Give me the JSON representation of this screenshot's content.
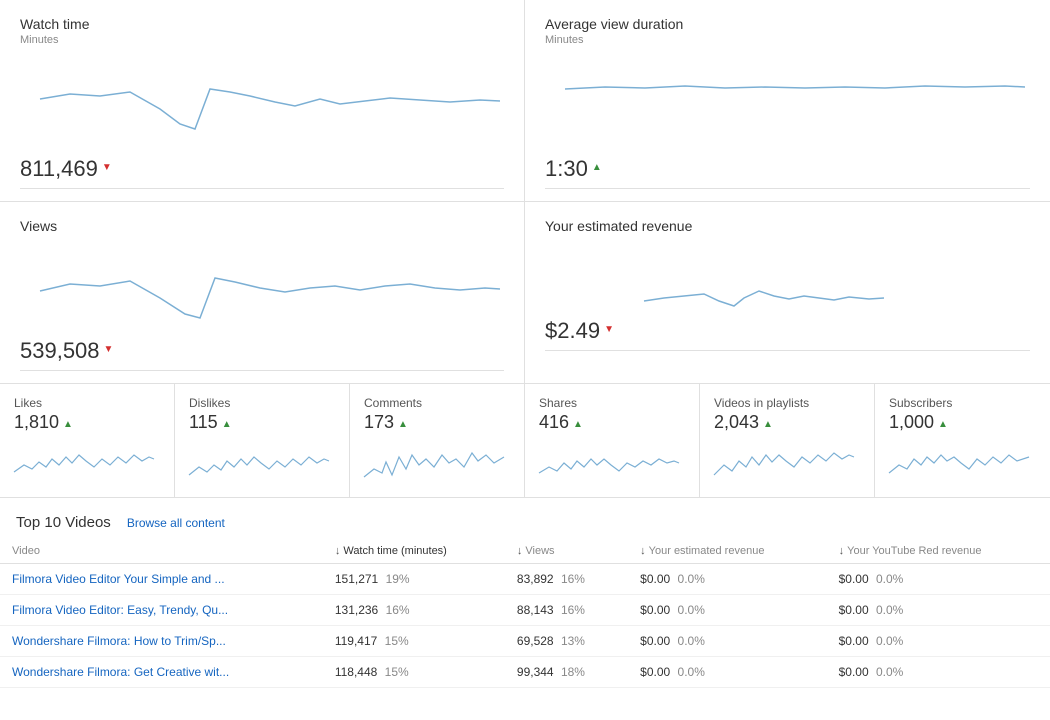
{
  "metrics": {
    "watch_time": {
      "title": "Watch time",
      "subtitle": "Minutes",
      "value": "811,469",
      "trend": "down"
    },
    "avg_view_duration": {
      "title": "Average view duration",
      "subtitle": "Minutes",
      "value": "1:30",
      "trend": "up"
    },
    "views": {
      "title": "Views",
      "value": "539,508",
      "trend": "down"
    },
    "estimated_revenue": {
      "title": "Your estimated revenue",
      "value": "$2.49",
      "trend": "down"
    }
  },
  "small_metrics": [
    {
      "title": "Likes",
      "value": "1,810",
      "trend": "up"
    },
    {
      "title": "Dislikes",
      "value": "115",
      "trend": "up"
    },
    {
      "title": "Comments",
      "value": "173",
      "trend": "up"
    },
    {
      "title": "Shares",
      "value": "416",
      "trend": "up"
    },
    {
      "title": "Videos in playlists",
      "value": "2,043",
      "trend": "up"
    },
    {
      "title": "Subscribers",
      "value": "1,000",
      "trend": "up"
    }
  ],
  "top_videos": {
    "title": "Top 10 Videos",
    "browse_label": "Browse all content",
    "columns": {
      "video": "Video",
      "watch_time": "Watch time (minutes)",
      "views": "Views",
      "est_revenue": "Your estimated revenue",
      "yt_red_revenue": "Your YouTube Red revenue"
    },
    "rows": [
      {
        "title": "Filmora Video Editor Your Simple and ...",
        "watch_time": "151,271",
        "watch_pct": "19%",
        "views": "83,892",
        "views_pct": "16%",
        "est_rev": "$0.00",
        "est_rev_pct": "0.0%",
        "yt_red_rev": "$0.00",
        "yt_red_pct": "0.0%"
      },
      {
        "title": "Filmora Video Editor: Easy, Trendy, Qu...",
        "watch_time": "131,236",
        "watch_pct": "16%",
        "views": "88,143",
        "views_pct": "16%",
        "est_rev": "$0.00",
        "est_rev_pct": "0.0%",
        "yt_red_rev": "$0.00",
        "yt_red_pct": "0.0%"
      },
      {
        "title": "Wondershare Filmora: How to Trim/Sp...",
        "watch_time": "119,417",
        "watch_pct": "15%",
        "views": "69,528",
        "views_pct": "13%",
        "est_rev": "$0.00",
        "est_rev_pct": "0.0%",
        "yt_red_rev": "$0.00",
        "yt_red_pct": "0.0%"
      },
      {
        "title": "Wondershare Filmora: Get Creative wit...",
        "watch_time": "118,448",
        "watch_pct": "15%",
        "views": "99,344",
        "views_pct": "18%",
        "est_rev": "$0.00",
        "est_rev_pct": "0.0%",
        "yt_red_rev": "$0.00",
        "yt_red_pct": "0.0%"
      }
    ]
  }
}
